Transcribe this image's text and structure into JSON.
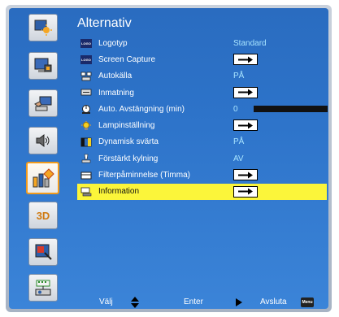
{
  "menu": {
    "title": "Alternativ",
    "rows": [
      {
        "label": "Logotyp",
        "value": "Standard",
        "icon": "logo-icon"
      },
      {
        "label": "Screen Capture",
        "value": "",
        "icon": "logo-icon"
      },
      {
        "label": "Autokälla",
        "value": "PÅ",
        "icon": "source-icon"
      },
      {
        "label": "Inmatning",
        "value": "",
        "icon": "input-icon"
      },
      {
        "label": "Auto. Avstängning (min)",
        "value": "0",
        "icon": "power-timer-icon"
      },
      {
        "label": "Lampinställning",
        "value": "",
        "icon": "lamp-icon"
      },
      {
        "label": "Dynamisk svärta",
        "value": "PÅ",
        "icon": "dynamic-black-icon"
      },
      {
        "label": "Förstärkt kylning",
        "value": "AV",
        "icon": "cooling-icon"
      },
      {
        "label": "Filterpåminnelse (Timma)",
        "value": "",
        "icon": "filter-icon"
      },
      {
        "label": "Information",
        "value": "",
        "icon": "info-icon"
      }
    ]
  },
  "footer": {
    "select_label": "Välj",
    "enter_label": "Enter",
    "exit_label": "Avsluta",
    "menu_key": "Menu"
  },
  "rail": [
    "image-icon",
    "display-icon",
    "setup-icon",
    "audio-icon",
    "options-icon",
    "3d-icon",
    "interactive-icon",
    "network-icon"
  ],
  "rail_3d_label": "3D",
  "colors": {
    "background": "#2d73c9",
    "selected_row": "#fbf53a",
    "value_text": "#a8e4ff",
    "active_rail_border": "#f19a1c"
  }
}
